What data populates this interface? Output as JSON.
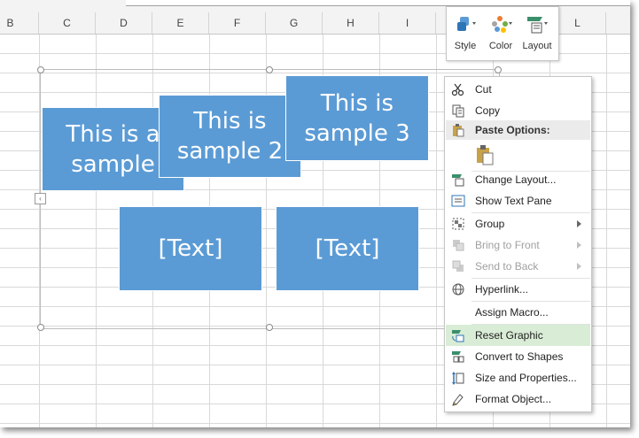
{
  "columns": [
    "B",
    "C",
    "D",
    "E",
    "F",
    "G",
    "H",
    "I",
    "",
    "",
    "L"
  ],
  "smartart": {
    "boxes": [
      {
        "text": "This is a sample"
      },
      {
        "text": "This is sample 2"
      },
      {
        "text": "This is sample 3"
      },
      {
        "text": "[Text]"
      },
      {
        "text": "[Text]"
      }
    ],
    "fill_color": "#5b9bd5"
  },
  "mini_toolbar": {
    "style_label": "Style",
    "color_label": "Color",
    "layout_label": "Layout"
  },
  "context_menu": {
    "cut": "Cut",
    "copy": "Copy",
    "paste_options": "Paste Options:",
    "change_layout": "Change Layout...",
    "show_text_pane": "Show Text Pane",
    "group": "Group",
    "bring_to_front": "Bring to Front",
    "send_to_back": "Send to Back",
    "hyperlink": "Hyperlink...",
    "assign_macro": "Assign Macro...",
    "reset_graphic": "Reset Graphic",
    "convert_to_shapes": "Convert to Shapes",
    "size_and_properties": "Size and Properties...",
    "format_object": "Format Object...",
    "highlight_color": "#d9ecd6"
  }
}
